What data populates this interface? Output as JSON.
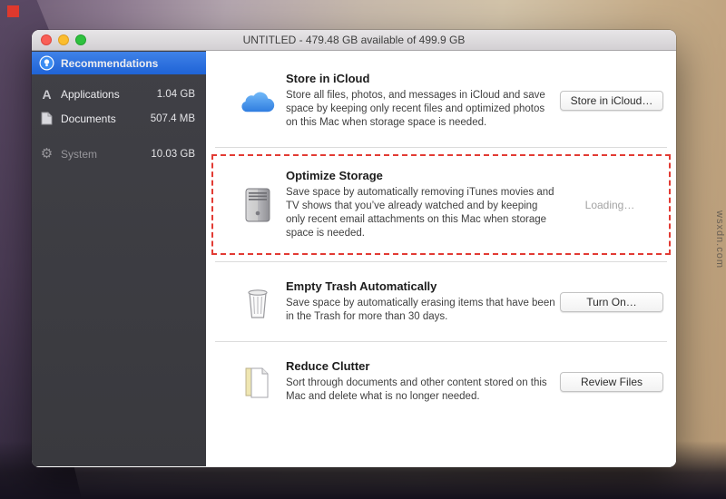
{
  "desktop": {
    "watermark": "wsxdn.com"
  },
  "window": {
    "title": "UNTITLED - 479.48 GB available of 499.9 GB",
    "sidebar": {
      "items": [
        {
          "label": "Recommendations",
          "size": "",
          "selected": true,
          "icon": "lightbulb-circle-icon"
        },
        {
          "label": "Applications",
          "size": "1.04 GB",
          "icon": "applications-a-icon"
        },
        {
          "label": "Documents",
          "size": "507.4 MB",
          "icon": "document-icon"
        },
        {
          "label": "System",
          "size": "10.03 GB",
          "disabled": true,
          "icon": "gear-icon"
        }
      ]
    },
    "sections": [
      {
        "title": "Store in iCloud",
        "description": "Store all files, photos, and messages in iCloud and save space by keeping only recent files and optimized photos on this Mac when storage space is needed.",
        "action": "Store in iCloud…",
        "action_type": "button",
        "icon": "icloud-cloud-icon"
      },
      {
        "title": "Optimize Storage",
        "description": "Save space by automatically removing iTunes movies and TV shows that you’ve already watched and by keeping only recent email attachments on this Mac when storage space is needed.",
        "action": "Loading…",
        "action_type": "loading",
        "highlighted": true,
        "icon": "hard-drive-icon",
        "highlight_color": "#e23b34"
      },
      {
        "title": "Empty Trash Automatically",
        "description": "Save space by automatically erasing items that have been in the Trash for more than 30 days.",
        "action": "Turn On…",
        "action_type": "button",
        "icon": "trash-icon"
      },
      {
        "title": "Reduce Clutter",
        "description": "Sort through documents and other content stored on this Mac and delete what is no longer needed.",
        "action": "Review Files",
        "action_type": "button",
        "icon": "documents-stack-icon"
      }
    ]
  }
}
